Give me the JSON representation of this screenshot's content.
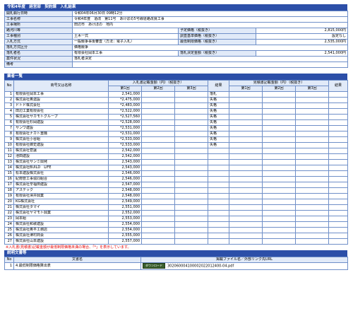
{
  "header": {
    "title": "令和4年度　経営部　契約課　入札結果"
  },
  "info": {
    "rows": [
      {
        "label": "開札執行日時",
        "value": "令和04年06月30日 09時12分"
      },
      {
        "label": "工事名称",
        "value": "令和4年度　道改　第11号　あけぼの5号線道路改良工事"
      },
      {
        "label": "工事場所",
        "value": "田辺市　あけぼの　地内"
      },
      {
        "label": "路河川等",
        "value": "",
        "label2": "予定価格（税抜き）",
        "value2": "2,815,000円"
      },
      {
        "label": "工事種別",
        "value": "土木一式",
        "label2": "調査基準価格（税抜き）",
        "value2": "設定なし"
      },
      {
        "label": "入札方式",
        "value": "一般競争事後審査（方法：電子入札）",
        "label2": "最低制限価格（税抜き）",
        "value2": "2,535,000円"
      },
      {
        "label": "落札方式区分",
        "value": "価格競争"
      },
      {
        "label": "落札者名",
        "value": "有限会社岡本工事",
        "label2": "落札決定金額（税抜き）",
        "value2": "2,541,000円"
      },
      {
        "label": "案件状況",
        "value": "落札者決定"
      },
      {
        "label": "備考",
        "value": ""
      }
    ]
  },
  "bidders": {
    "section_title": "業者一覧",
    "col_no": "No",
    "col_name": "商号又は名称",
    "col_bid_group": "入札書記載金額（円）（税抜き）",
    "col_result": "結果",
    "col_price_group": "見積書記載金額（円）（税抜き）",
    "col_result2": "結果",
    "round1": "第1回",
    "round2": "第2回",
    "round3": "第3回",
    "rows": [
      {
        "no": "1",
        "name": "有限会社岡本工事",
        "bid": "2,541,000",
        "result": "落札"
      },
      {
        "no": "2",
        "name": "株式会社奥濃設",
        "bid": "*2,475,000",
        "result": "失格"
      },
      {
        "no": "3",
        "name": "ドトド株式会社",
        "bid": "*2,483,000",
        "result": "失格"
      },
      {
        "no": "4",
        "name": "田辺工業有限会社",
        "bid": "*2,522,000",
        "result": "失格"
      },
      {
        "no": "5",
        "name": "株式会社サカモトグループ",
        "bid": "*2,527,560",
        "result": "失格"
      },
      {
        "no": "6",
        "name": "有限会社杉岡建設",
        "bid": "*2,528,000",
        "result": "失格"
      },
      {
        "no": "7",
        "name": "サンワ建設",
        "bid": "*2,531,000",
        "result": "失格"
      },
      {
        "no": "8",
        "name": "有限会社ナカト重機",
        "bid": "*2,531,000",
        "result": "失格"
      },
      {
        "no": "9",
        "name": "株式会社小谷組",
        "bid": "*2,533,000",
        "result": "失格"
      },
      {
        "no": "10",
        "name": "有限会社御史建設",
        "bid": "*2,533,000",
        "result": "失格"
      },
      {
        "no": "11",
        "name": "株式会社菅讓",
        "bid": "2,542,000",
        "result": ""
      },
      {
        "no": "12",
        "name": "池田建設",
        "bid": "2,542,000",
        "result": ""
      },
      {
        "no": "13",
        "name": "株式会社サンミ興発",
        "bid": "2,543,000",
        "result": ""
      },
      {
        "no": "14",
        "name": "株式会社BUILD　LIFE",
        "bid": "2,543,000",
        "result": ""
      },
      {
        "no": "15",
        "name": "松本建設株式会社",
        "bid": "2,546,000",
        "result": ""
      },
      {
        "no": "16",
        "name": "紀南管工事協同組合",
        "bid": "2,546,000",
        "result": ""
      },
      {
        "no": "17",
        "name": "株式会社辛福田建設",
        "bid": "2,547,000",
        "result": ""
      },
      {
        "no": "18",
        "name": "アステック",
        "bid": "2,548,000",
        "result": ""
      },
      {
        "no": "19",
        "name": "有限会社澤井興業",
        "bid": "2,548,000",
        "result": ""
      },
      {
        "no": "20",
        "name": "KG株式会社",
        "bid": "2,549,000",
        "result": ""
      },
      {
        "no": "21",
        "name": "株式会社タマイ",
        "bid": "2,551,000",
        "result": ""
      },
      {
        "no": "22",
        "name": "株式会社ヤマモト興業",
        "bid": "2,552,000",
        "result": ""
      },
      {
        "no": "23",
        "name": "岡本組",
        "bid": "2,553,000",
        "result": ""
      },
      {
        "no": "24",
        "name": "株式会社和歌建設",
        "bid": "2,554,000",
        "result": ""
      },
      {
        "no": "25",
        "name": "株式会社奥平工務店",
        "bid": "2,554,000",
        "result": ""
      },
      {
        "no": "26",
        "name": "株式会社津村商会",
        "bid": "2,555,000",
        "result": ""
      },
      {
        "no": "27",
        "name": "株式会社山本建設",
        "bid": "2,557,000",
        "result": ""
      }
    ],
    "note": "※入札書(見積書)記載金額が最低制限価格未満の場合、「*」を表示しています。"
  },
  "attachments": {
    "section_title": "説明文書等",
    "col_no": "No",
    "col_doc": "文書名",
    "col_file": "掲載ファイル名／外部リンク先URL",
    "rows": [
      {
        "no": "1",
        "doc": "4.最低制限価格算出表",
        "button": "ダウンロード",
        "file": "3020600041000020220124​00-04.pdf"
      }
    ]
  }
}
